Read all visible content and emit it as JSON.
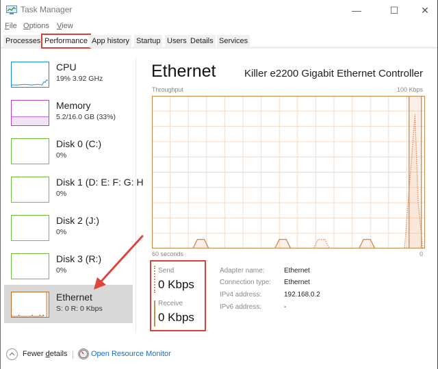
{
  "window": {
    "title": "Task Manager",
    "controls": {
      "minimize": "—",
      "maximize": "☐",
      "close": "✕"
    }
  },
  "menu": [
    {
      "label": "File",
      "accel": "F",
      "rest": "ile"
    },
    {
      "label": "Options",
      "accel": "O",
      "rest": "ptions"
    },
    {
      "label": "View",
      "accel": "V",
      "rest": "iew"
    }
  ],
  "tabs": [
    {
      "label": "Processes",
      "active": false
    },
    {
      "label": "Performance",
      "active": true
    },
    {
      "label": "App history",
      "active": false
    },
    {
      "label": "Startup",
      "active": false
    },
    {
      "label": "Users",
      "active": false
    },
    {
      "label": "Details",
      "active": false
    },
    {
      "label": "Services",
      "active": false
    }
  ],
  "sidebar": {
    "items": [
      {
        "name": "CPU",
        "sub": "19%  3.92 GHz",
        "color": "#1a8ad4",
        "selected": false
      },
      {
        "name": "Memory",
        "sub": "5.2/16.0 GB (33%)",
        "color": "#b040c8",
        "selected": false
      },
      {
        "name": "Disk 0 (C:)",
        "sub": "0%",
        "color": "#6cbf3d",
        "selected": false
      },
      {
        "name": "Disk 1 (D: E: F: G: H",
        "sub": "0%",
        "color": "#6cbf3d",
        "selected": false
      },
      {
        "name": "Disk 2 (J:)",
        "sub": "0%",
        "color": "#6cbf3d",
        "selected": false
      },
      {
        "name": "Disk 3 (R:)",
        "sub": "0%",
        "color": "#6cbf3d",
        "selected": false
      },
      {
        "name": "Ethernet",
        "sub": "S: 0 R: 0 Kbps",
        "color": "#c06a28",
        "selected": true
      }
    ]
  },
  "main": {
    "title": "Ethernet",
    "adapter_model": "Killer e2200 Gigabit Ethernet Controller",
    "graph": {
      "label_left": "Throughput",
      "label_right": "100 Kbps",
      "x_left": "60 seconds",
      "x_right": "0",
      "accent": "#c98a4e"
    },
    "send": {
      "label": "Send",
      "value": "0 Kbps"
    },
    "receive": {
      "label": "Receive",
      "value": "0 Kbps"
    },
    "info": [
      {
        "key": "Adapter name:",
        "value": "Ethernet"
      },
      {
        "key": "Connection type:",
        "value": "Ethernet"
      },
      {
        "key": "IPv4 address:",
        "value": "192.168.0.2"
      },
      {
        "key": "IPv6 address:",
        "value": "-"
      }
    ]
  },
  "footer": {
    "fewer_details": "Fewer details",
    "fewer_accel_pre": "Fewer ",
    "fewer_accel": "d",
    "fewer_accel_post": "etails",
    "resource_monitor": "Open Resource Monitor"
  },
  "chart_data": {
    "type": "area",
    "title": "Throughput",
    "xlabel": "60 seconds",
    "ylabel": "Kbps",
    "xlim": [
      60,
      0
    ],
    "ylim": [
      0,
      100
    ],
    "grid": true,
    "series": [
      {
        "name": "Receive",
        "style": "solid",
        "points": [
          [
            60,
            0
          ],
          [
            51,
            0
          ],
          [
            50,
            6
          ],
          [
            48.5,
            6
          ],
          [
            47.5,
            0
          ],
          [
            33,
            0
          ],
          [
            32,
            6
          ],
          [
            30.5,
            6
          ],
          [
            29.5,
            0
          ],
          [
            14.5,
            0
          ],
          [
            13.5,
            6
          ],
          [
            12,
            6
          ],
          [
            11,
            0
          ],
          [
            3.5,
            0
          ],
          [
            3.5,
            100
          ],
          [
            0.8,
            100
          ],
          [
            0.8,
            0
          ],
          [
            0,
            0
          ]
        ]
      },
      {
        "name": "Send",
        "style": "dotted",
        "points": [
          [
            60,
            0
          ],
          [
            24.5,
            0
          ],
          [
            23.5,
            6
          ],
          [
            22,
            6
          ],
          [
            21,
            0
          ],
          [
            4.5,
            0
          ],
          [
            2.2,
            88
          ],
          [
            1.5,
            30
          ],
          [
            0.5,
            0
          ],
          [
            0,
            0
          ]
        ]
      }
    ]
  }
}
